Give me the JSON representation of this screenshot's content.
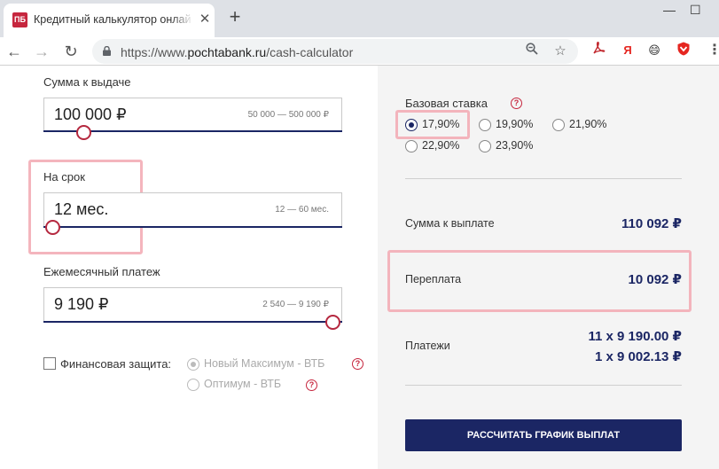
{
  "browser": {
    "tab_title": "Кредитный калькулятор онлайн",
    "favicon_text": "ПБ",
    "url_scheme": "https://www.",
    "url_host": "pochtabank.ru",
    "url_path": "/cash-calculator",
    "icons": [
      "back-arrow-icon",
      "forward-arrow-icon",
      "reload-icon",
      "lock-icon",
      "zoom-icon",
      "star-icon",
      "pdf-icon",
      "yandex-icon",
      "emoji-icon",
      "shield-icon",
      "menu-icon"
    ],
    "ext_yandex": "Я",
    "ext_emoji": "😄"
  },
  "calculator": {
    "amount": {
      "label": "Сумма к выдаче",
      "value": "100 000 ₽",
      "range": "50 000 — 500 000 ₽",
      "position_fraction": 0.111
    },
    "term": {
      "label": "На срок",
      "value": "12 мес.",
      "range": "12 — 60 мес.",
      "position_fraction": 0.0
    },
    "monthly": {
      "label": "Ежемесячный платеж",
      "value": "9 190 ₽",
      "range": "2 540 — 9 190 ₽",
      "position_fraction": 1.0
    },
    "protection": {
      "label": "Финансовая защита:",
      "options": [
        {
          "label": "Новый Максимум - ВТБ",
          "checked": true
        },
        {
          "label": "Оптимум - ВТБ",
          "checked": false
        }
      ]
    }
  },
  "summary": {
    "rate_label": "Базовая ставка",
    "rates": [
      {
        "label": "17,90%",
        "checked": true
      },
      {
        "label": "19,90%",
        "checked": false
      },
      {
        "label": "21,90%",
        "checked": false
      },
      {
        "label": "22,90%",
        "checked": false
      },
      {
        "label": "23,90%",
        "checked": false
      }
    ],
    "total_label": "Сумма к выплате",
    "total_value": "110 092 ₽",
    "overpay_label": "Переплата",
    "overpay_value": "10 092 ₽",
    "payments_label": "Платежи",
    "payments_line1": "11 x 9 190.00 ₽",
    "payments_line2": "1 x 9 002.13 ₽",
    "cta_label": "РАССЧИТАТЬ ГРАФИК ВЫПЛАТ"
  },
  "colors": {
    "brand_navy": "#1b2664",
    "brand_red": "#c6263e",
    "highlight": "#f2a8b2"
  }
}
